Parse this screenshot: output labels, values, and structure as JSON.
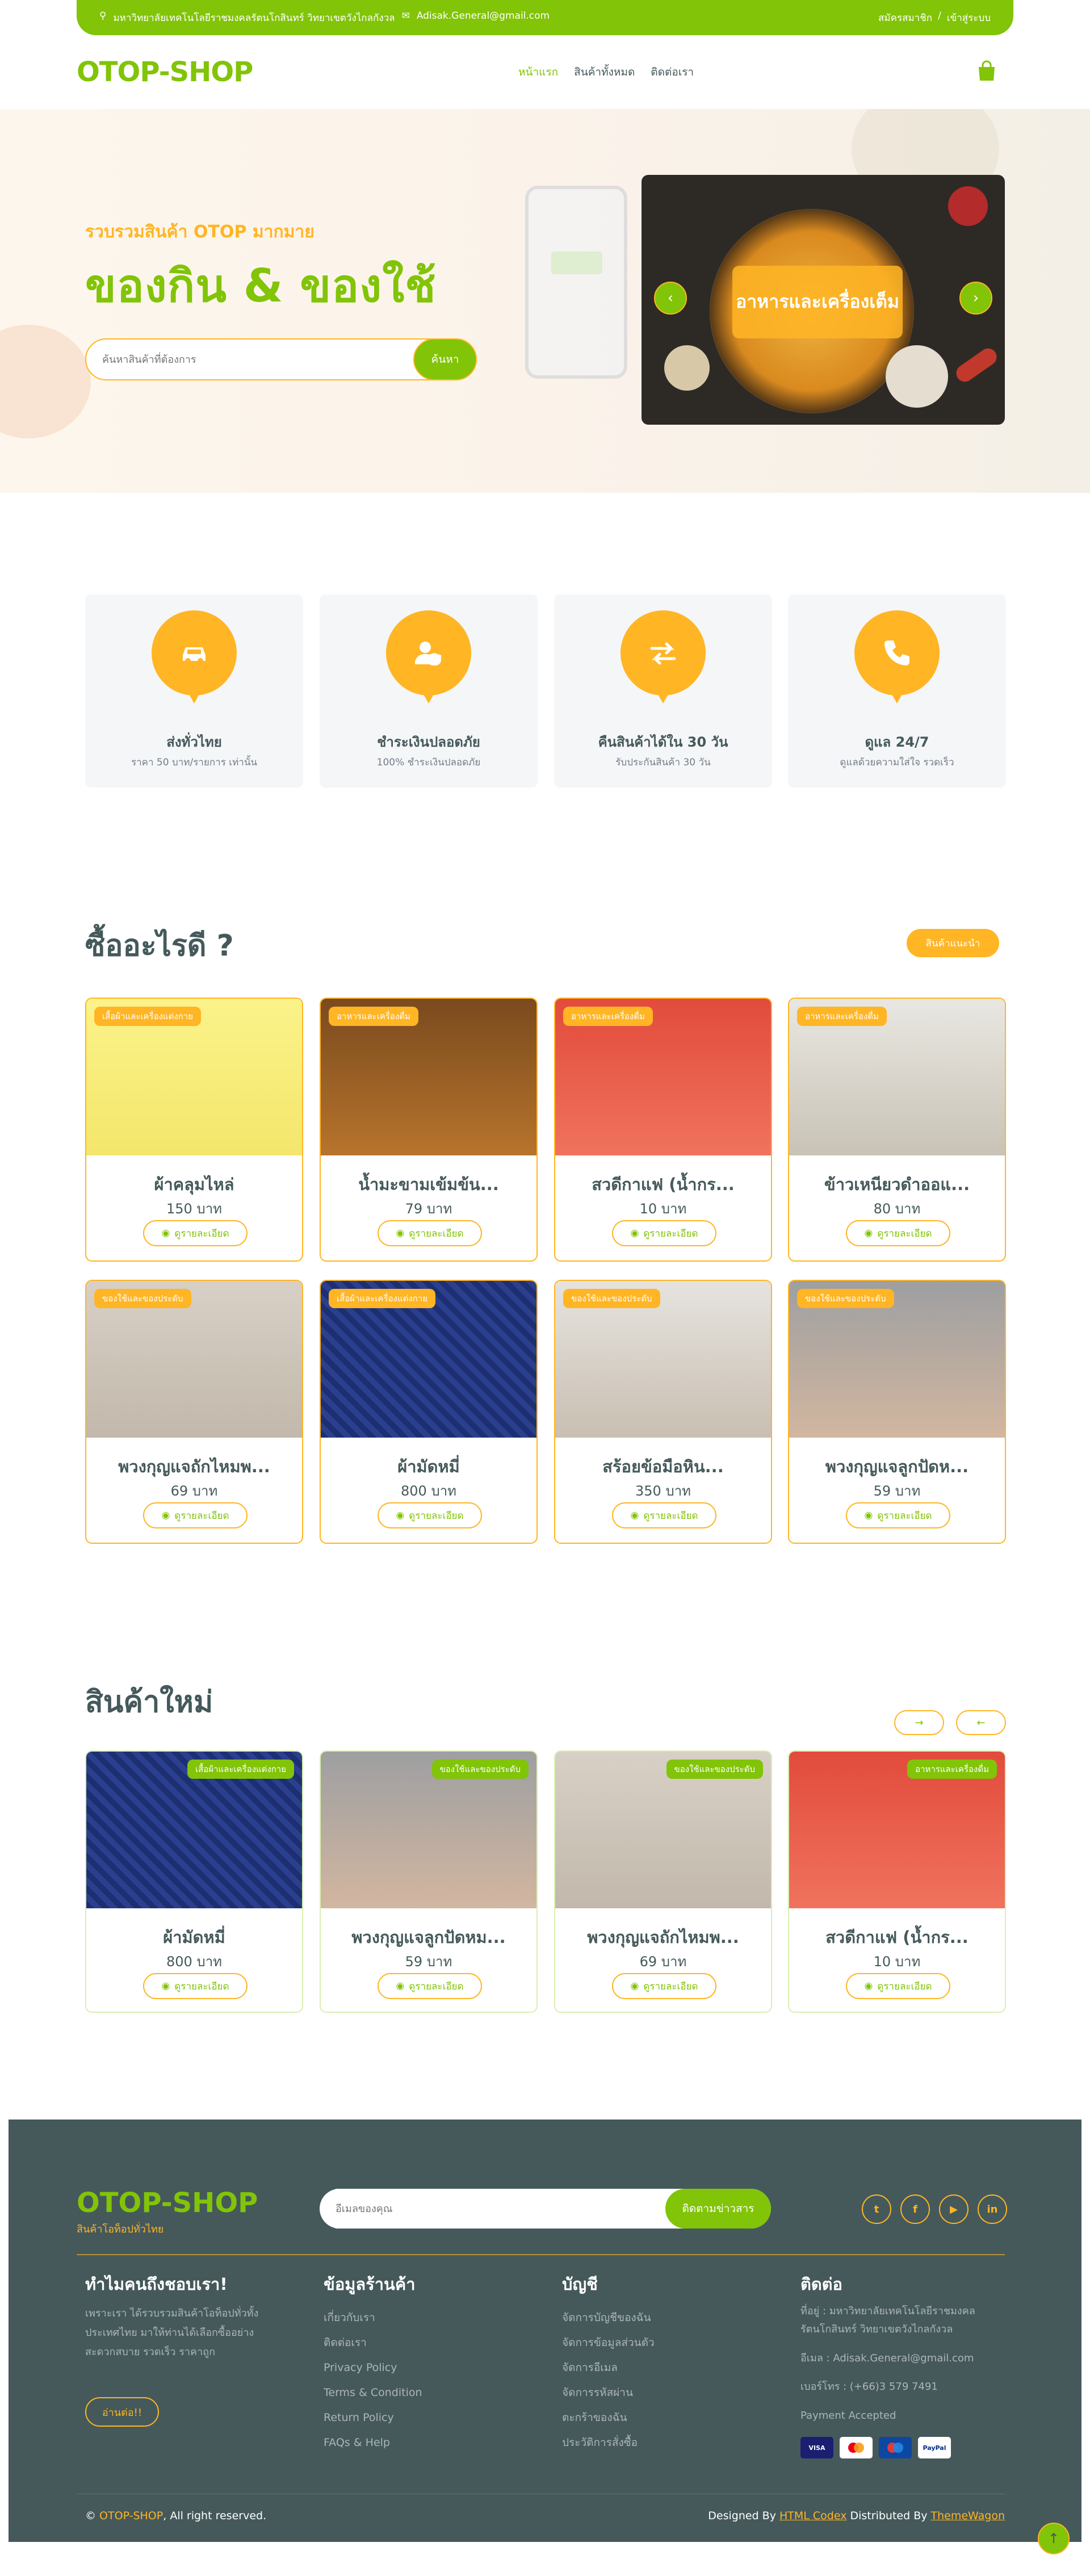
{
  "topbar": {
    "address": "มหาวิทยาลัยเทคโนโลยีราชมงคลรัตนโกสินทร์ วิทยาเขตวังไกลกังวล",
    "email": "Adisak.General@gmail.com",
    "register": "สมัครสมาชิก",
    "sep": "/",
    "login": "เข้าสู่ระบบ"
  },
  "nav": {
    "brand": "OTOP-SHOP",
    "items": [
      "หน้าแรก",
      "สินค้าทั้งหมด",
      "ติดต่อเรา"
    ]
  },
  "hero": {
    "subtitle": "รวบรวมสินค้า OTOP มากมาย",
    "title": "ของกิน & ของใช้",
    "search_placeholder": "ค้นหาสินค้าที่ต้องการ",
    "search_btn": "ค้นหา",
    "carousel_caption": "อาหารและเครื่องเต็ม"
  },
  "features": [
    {
      "title": "ส่งทั่วไทย",
      "desc": "ราคา 50 บาท/รายการ เท่านั้น"
    },
    {
      "title": "ชำระเงินปลอดภัย",
      "desc": "100% ชำระเงินปลอดภัย"
    },
    {
      "title": "คืนสินค้าได้ใน 30 วัน",
      "desc": "รับประกันสินค้า 30 วัน"
    },
    {
      "title": "ดูแล 24/7",
      "desc": "ดูแลด้วยความใส่ใจ รวดเร็ว"
    }
  ],
  "buy": {
    "title": "ซื้ออะไรดี ?",
    "badge": "สินค้าแนะนำ",
    "detail_label": "ดูรายละเอียด",
    "products": [
      {
        "tag": "เสื้อผ้าและเครื่องแต่งกาย",
        "name": "ผ้าคลุมไหล่",
        "price": "150 บาท"
      },
      {
        "tag": "อาหารและเครื่องดื่ม",
        "name": "น้ำมะขามเข้มข้น...",
        "price": "79 บาท"
      },
      {
        "tag": "อาหารและเครื่องดื่ม",
        "name": "สวดีกาแฟ (น้ำกร...",
        "price": "10 บาท"
      },
      {
        "tag": "อาหารและเครื่องดื่ม",
        "name": "ข้าวเหนียวดำออแ...",
        "price": "80 บาท"
      },
      {
        "tag": "ของใช้และของประดับ",
        "name": "พวงกุญแจถักไหมพ...",
        "price": "69 บาท"
      },
      {
        "tag": "เสื้อผ้าและเครื่องแต่งกาย",
        "name": "ผ้ามัดหมี่",
        "price": "800 บาท"
      },
      {
        "tag": "ของใช้และของประดับ",
        "name": "สร้อยข้อมือหิน...",
        "price": "350 บาท"
      },
      {
        "tag": "ของใช้และของประดับ",
        "name": "พวงกุญแจลูกปัดห...",
        "price": "59 บาท"
      }
    ]
  },
  "new": {
    "title": "สินค้าใหม่",
    "next": "→",
    "prev": "←",
    "products": [
      {
        "tag": "เสื้อผ้าและเครื่องแต่งกาย",
        "name": "ผ้ามัดหมี่",
        "price": "800 บาท"
      },
      {
        "tag": "ของใช้และของประดับ",
        "name": "พวงกุญแจลูกปัดหม...",
        "price": "59 บาท"
      },
      {
        "tag": "ของใช้และของประดับ",
        "name": "พวงกุญแจถักไหมพ...",
        "price": "69 บาท"
      },
      {
        "tag": "อาหารและเครื่องดื่ม",
        "name": "สวดีกาแฟ (น้ำกร...",
        "price": "10 บาท"
      }
    ]
  },
  "footer": {
    "brand": "OTOP-SHOP",
    "tagline": "สินค้าโอท็อปทั่วไทย",
    "sub_placeholder": "อีเมลของคุณ",
    "sub_btn": "ติดตามข่าวสาร",
    "col1": {
      "title": "ทำไมคนถึงชอบเรา!",
      "text": [
        "เพราะเรา ได้รวบรวมสินค้าโอท็อปทั่วทั้ง",
        "ประเทศไทย มาให้ท่านได้เลือกซื้ออย่าง",
        "สะดวกสบาย รวดเร็ว ราคาถูก"
      ],
      "btn": "อ่านต่อ!!"
    },
    "col2": {
      "title": "ข้อมูลร้านค้า",
      "links": [
        "เกี่ยวกับเรา",
        "ติดต่อเรา",
        "Privacy Policy",
        "Terms & Condition",
        "Return Policy",
        "FAQs & Help"
      ]
    },
    "col3": {
      "title": "บัญชี",
      "links": [
        "จัดการบัญชีของฉัน",
        "จัดการข้อมูลส่วนตัว",
        "จัดการอีเมล",
        "จัดการรหัสผ่าน",
        "ตะกร้าของฉัน",
        "ประวัติการสั่งซื้อ"
      ]
    },
    "col4": {
      "title": "ติดต่อ",
      "address1": "ที่อยู่ : มหาวิทยาลัยเทคโนโลยีราชมงคล",
      "address2": "รัตนโกสินทร์ วิทยาเขตวังไกลกังวล",
      "email": "อีเมล : Adisak.General@gmail.com",
      "phone": "เบอร์โทร : (+66)3 579 7491",
      "payment": "Payment Accepted"
    },
    "copyright_brand": "OTOP-SHOP",
    "copyright_rest": ", All right reserved.",
    "designed_by": "Designed By",
    "html_codex": "HTML Codex",
    "distributed_by": "Distributed By",
    "themewagon": "ThemeWagon"
  },
  "colors": {
    "primary": "#81c408",
    "secondary": "#ffb524",
    "dark": "#45595b"
  }
}
